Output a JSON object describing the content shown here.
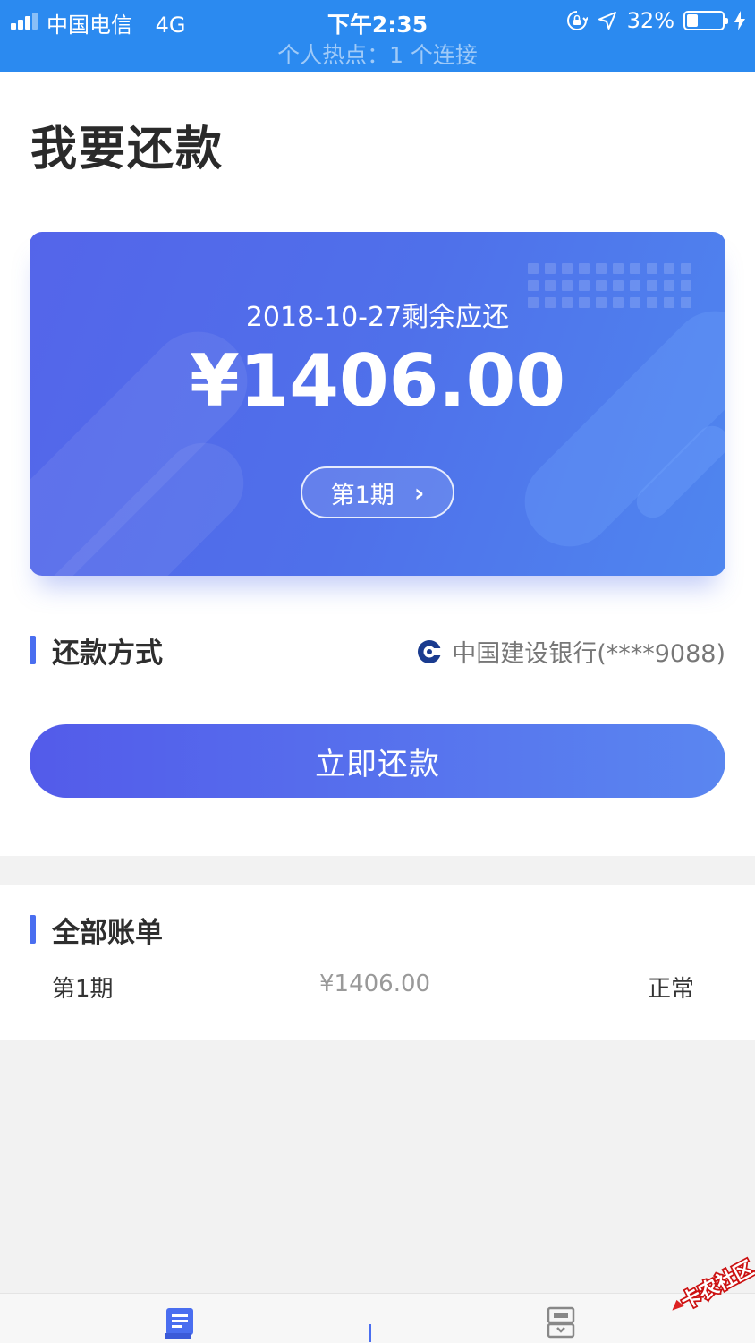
{
  "status_bar": {
    "carrier": "中国电信",
    "network": "4G",
    "time": "下午2:35",
    "battery_percent": "32%",
    "battery_level": 0.32,
    "hotspot": "个人热点：1 个连接"
  },
  "page": {
    "title": "我要还款"
  },
  "card": {
    "due_label": "2018-10-27剩余应还",
    "amount": "¥1406.00",
    "period_button": "第1期"
  },
  "payment_method": {
    "label": "还款方式",
    "bank": "中国建设银行(****9088)"
  },
  "pay_button": "立即还款",
  "bills": {
    "label": "全部账单",
    "rows": [
      {
        "period": "第1期",
        "amount": "¥1406.00",
        "status": "正常"
      }
    ]
  },
  "tab_bar": {
    "icons": [
      "bill-list-icon",
      "mine-icon"
    ]
  },
  "watermark": {
    "text": "卡农社区"
  },
  "colors": {
    "status_bar": "#2b8af0",
    "accent": "#4a6ef0",
    "card_start": "#5465ea",
    "card_end": "#4f86ef"
  }
}
